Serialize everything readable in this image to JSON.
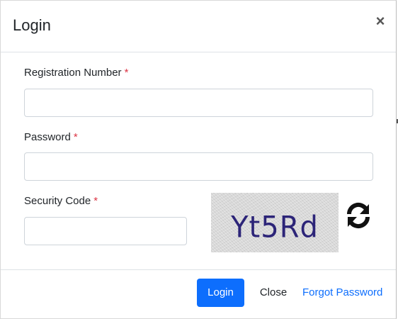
{
  "modal": {
    "title": "Login",
    "close_icon": "close-icon"
  },
  "form": {
    "registration_label": "Registration Number",
    "registration_value": "",
    "password_label": "Password",
    "password_value": "",
    "security_label": "Security Code",
    "security_value": "",
    "required_mark": "*",
    "captcha_text": "Yt5Rd",
    "refresh_icon": "refresh-icon"
  },
  "footer": {
    "login_label": "Login",
    "close_label": "Close",
    "forgot_label": "Forgot Password"
  },
  "colors": {
    "primary": "#0d6efd",
    "required": "#dc3545",
    "captcha_text": "#2c2478"
  }
}
